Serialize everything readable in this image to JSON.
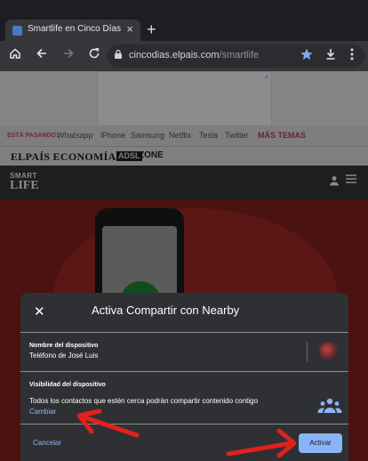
{
  "browser": {
    "tab_title": "Smartlife en Cinco Días",
    "tab_close": "×",
    "new_tab": "+",
    "url_host": "cincodias.elpais.com",
    "url_path": "/smartlife",
    "icons": [
      "home-icon",
      "back-icon",
      "forward-icon",
      "reload-icon",
      "lock-icon",
      "star-icon",
      "download-icon",
      "menu-icon"
    ]
  },
  "site": {
    "ad_mark": "✕",
    "hot_label": "ESTÁ PASANDO:",
    "nav_links": [
      "Whatsapp",
      "iPhone",
      "Samsung",
      "Netflix",
      "Tesla",
      "Twitter"
    ],
    "more_topics": "MÁS TEMAS",
    "brand_elpais": "ELPAÍS ECONOMÍA",
    "brand_adsl": "ADSL",
    "brand_zone": "ZONE",
    "logo_smart": "SMART",
    "logo_life": "LIFE"
  },
  "dialog": {
    "close_glyph": "✕",
    "title": "Activa Compartir con Nearby",
    "device_name_label": "Nombre del dispositivo",
    "device_name_value": "Teléfono de José Luis",
    "visibility_label": "Visibilidad del dispositivo",
    "visibility_desc": "Todos los contactos que estén cerca podrán compartir contenido contigo",
    "visibility_change": "Cambiar",
    "cancel_label": "Cancelar",
    "activate_label": "Activar"
  },
  "colors": {
    "accent": "#8ab4f8",
    "annotation": "#e0221c",
    "dialog_bg": "#2f3033"
  }
}
